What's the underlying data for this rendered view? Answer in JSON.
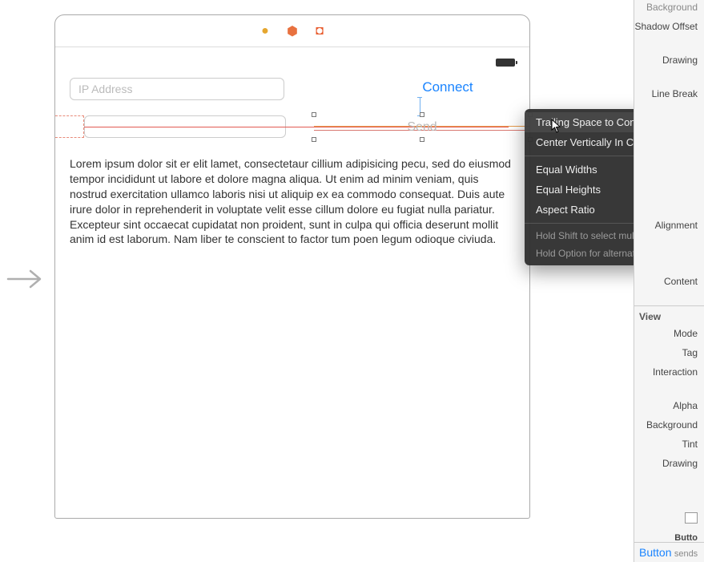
{
  "toolbar": {
    "icons": {
      "circle": "●",
      "cube": "⬢",
      "square": "◘"
    }
  },
  "fields": {
    "ip_placeholder": "IP Address",
    "connect_label": "Connect",
    "send_label": "Send"
  },
  "lorem_text": "Lorem ipsum dolor sit er elit lamet, consectetaur cillium adipisicing pecu, sed do eiusmod tempor incididunt ut labore et dolore magna aliqua. Ut enim ad minim veniam, quis nostrud exercitation ullamco laboris nisi ut aliquip ex ea commodo consequat. Duis aute irure dolor in reprehenderit in voluptate velit esse cillum dolore eu fugiat nulla pariatur. Excepteur sint occaecat cupidatat non proident, sunt in culpa qui officia deserunt mollit anim id est laborum. Nam liber te conscient to factor tum poen legum odioque civiuda.",
  "context_menu": {
    "items": [
      "Trailing Space to Container Margin",
      "Center Vertically In Container",
      "Equal Widths",
      "Equal Heights",
      "Aspect Ratio"
    ],
    "hint1": "Hold Shift to select multiple",
    "hint2": "Hold Option for alternates"
  },
  "inspector": {
    "background_label": "Background",
    "shadow_offset": "Shadow Offset",
    "drawing": "Drawing",
    "line_break": "Line Break",
    "alignment": "Alignment",
    "content": "Content",
    "section_view": "View",
    "mode": "Mode",
    "tag": "Tag",
    "interaction": "Interaction",
    "alpha": "Alpha",
    "background2": "Background",
    "tint": "Tint",
    "drawing2": "Drawing",
    "bottom_header": "Butto",
    "button_label": "Button",
    "button_sub": "sends"
  }
}
